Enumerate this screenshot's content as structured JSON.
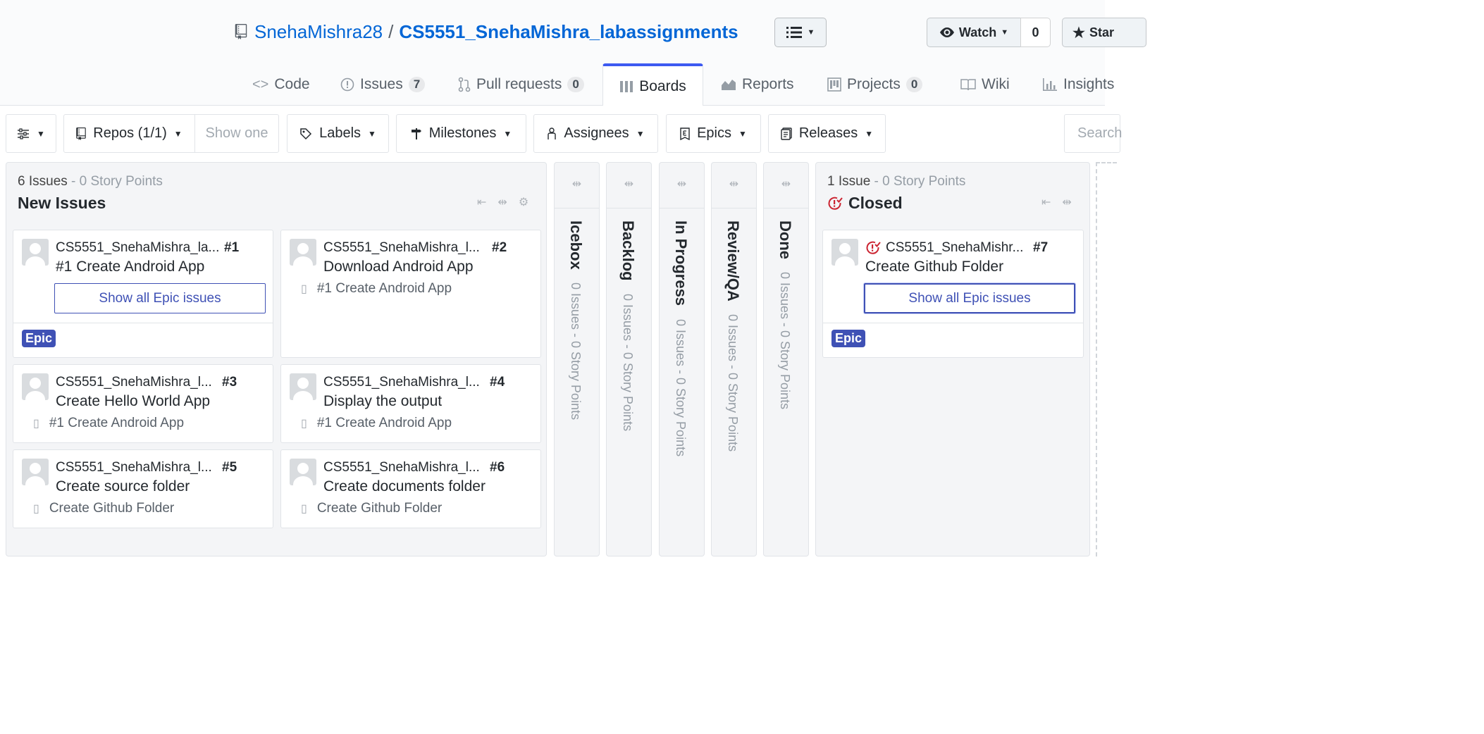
{
  "header": {
    "owner": "SnehaMishra28",
    "separator": "/",
    "repo": "CS5551_SnehaMishra_labassignments",
    "watch_label": "Watch",
    "watch_count": "0",
    "star_label": "Star"
  },
  "tabs": [
    {
      "label": "Code",
      "icon": "code-icon"
    },
    {
      "label": "Issues",
      "count": "7",
      "icon": "issue-icon"
    },
    {
      "label": "Pull requests",
      "count": "0",
      "icon": "pull-request-icon"
    },
    {
      "label": "Boards",
      "icon": "boards-icon",
      "selected": true
    },
    {
      "label": "Reports",
      "icon": "graph-icon"
    },
    {
      "label": "Projects",
      "count": "0",
      "icon": "project-icon"
    },
    {
      "label": "Wiki",
      "icon": "book-icon"
    },
    {
      "label": "Insights",
      "icon": "pulse-icon"
    }
  ],
  "filters": {
    "repos": "Repos (1/1)",
    "show_one": "Show one",
    "labels": "Labels",
    "milestones": "Milestones",
    "assignees": "Assignees",
    "epics": "Epics",
    "releases": "Releases",
    "search_placeholder": "Search"
  },
  "pipelines": {
    "new_issues": {
      "count": "6 Issues",
      "points": " - 0 Story Points",
      "title": "New Issues",
      "cards": [
        {
          "repo": "CS5551_SnehaMishra_la...",
          "num": "#1",
          "title": "#1 Create Android App",
          "epic_button": "Show all Epic issues",
          "badge": "Epic"
        },
        {
          "repo": "CS5551_SnehaMishra_l...",
          "num": "#2",
          "title": "Download Android App",
          "epic": "#1 Create Android App"
        },
        {
          "repo": "CS5551_SnehaMishra_l...",
          "num": "#3",
          "title": "Create Hello World App",
          "epic": "#1 Create Android App"
        },
        {
          "repo": "CS5551_SnehaMishra_l...",
          "num": "#4",
          "title": "Display the output",
          "epic": "#1 Create Android App"
        },
        {
          "repo": "CS5551_SnehaMishra_l...",
          "num": "#5",
          "title": "Create source folder",
          "epic": "Create Github Folder"
        },
        {
          "repo": "CS5551_SnehaMishra_l...",
          "num": "#6",
          "title": "Create documents folder",
          "epic": "Create Github Folder"
        }
      ]
    },
    "collapsed": [
      {
        "title": "Icebox",
        "count": "0 Issues - 0 Story Points"
      },
      {
        "title": "Backlog",
        "count": "0 Issues - 0 Story Points"
      },
      {
        "title": "In Progress",
        "count": "0 Issues - 0 Story Points"
      },
      {
        "title": "Review/QA",
        "count": "0 Issues - 0 Story Points"
      },
      {
        "title": "Done",
        "count": "0 Issues - 0 Story Points"
      }
    ],
    "closed": {
      "count": "1 Issue",
      "points": " - 0 Story Points",
      "title": "Closed",
      "cards": [
        {
          "repo": "CS5551_SnehaMishr...",
          "num": "#7",
          "title": "Create Github Folder",
          "epic_button": "Show all Epic issues",
          "badge": "Epic"
        }
      ]
    }
  },
  "colors": {
    "accent": "#3f51b5",
    "link": "#0366d6",
    "closed_icon": "#cb2431"
  }
}
